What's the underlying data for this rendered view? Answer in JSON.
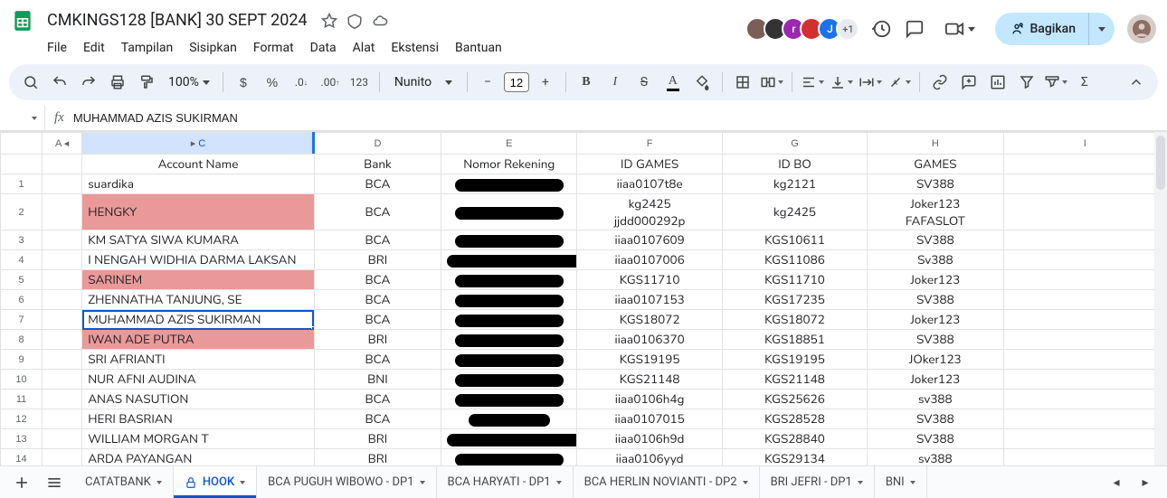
{
  "doc": {
    "title": "CMKINGS128 [BANK] 30 SEPT 2024"
  },
  "menus": {
    "file": "File",
    "edit": "Edit",
    "view": "Tampilan",
    "insert": "Sisipkan",
    "format": "Format",
    "data": "Data",
    "tools": "Alat",
    "ext": "Ekstensi",
    "help": "Bantuan"
  },
  "share": {
    "label": "Bagikan",
    "plus": "+1"
  },
  "toolbar": {
    "zoom": "100%",
    "font": "Nunito",
    "fontsize": "12",
    "num_token": "123"
  },
  "fx": {
    "name": "",
    "content": "MUHAMMAD AZIS SUKIRMAN"
  },
  "columns": [
    "A",
    "C",
    "D",
    "E",
    "F",
    "G",
    "H",
    "I"
  ],
  "headers": {
    "acct": "Account Name",
    "bank": "Bank",
    "rek": "Nomor Rekening",
    "idgames": "ID GAMES",
    "idbo": "ID BO",
    "games": "GAMES"
  },
  "rows": [
    {
      "n": "1",
      "acct": "suardika",
      "bank": "BCA",
      "hl": false,
      "idg": "iiaa0107t8e",
      "idbo": "kg2121",
      "games": "SV388",
      "rw": 120
    },
    {
      "n": "2",
      "acct": "HENGKY",
      "bank": "BCA",
      "hl": true,
      "idg": "kg2425\njjdd000292p",
      "idbo": "kg2425",
      "games": "Joker123\nFAFASLOT",
      "rw": 120,
      "tall": true
    },
    {
      "n": "3",
      "acct": "KM SATYA SIWA KUMARA",
      "bank": "BCA",
      "hl": false,
      "idg": "iiaa0107609",
      "idbo": "KGS10611",
      "games": "SV388",
      "rw": 120
    },
    {
      "n": "4",
      "acct": "I NENGAH WIDHIA DARMA LAKSAN",
      "bank": "BRI",
      "hl": false,
      "idg": "iiaa0107006",
      "idbo": "KGS11086",
      "games": "Sv388",
      "rw": 150
    },
    {
      "n": "5",
      "acct": "SARINEM",
      "bank": "BCA",
      "hl": true,
      "idg": "KGS11710",
      "idbo": "KGS11710",
      "games": "Joker123",
      "rw": 120
    },
    {
      "n": "6",
      "acct": "ZHENNATHA TANJUNG, SE",
      "bank": "BCA",
      "hl": false,
      "idg": "iiaa0107153",
      "idbo": "KGS17235",
      "games": "SV388",
      "rw": 120
    },
    {
      "n": "7",
      "acct": "MUHAMMAD AZIS SUKIRMAN",
      "bank": "BCA",
      "hl": false,
      "idg": "KGS18072",
      "idbo": "KGS18072",
      "games": "Joker123",
      "rw": 120,
      "active": true
    },
    {
      "n": "8",
      "acct": "IWAN ADE PUTRA",
      "bank": "BRI",
      "hl": true,
      "idg": "iiaa0106370",
      "idbo": "KGS18851",
      "games": "SV388",
      "rw": 120
    },
    {
      "n": "9",
      "acct": "SRI AFRIANTI",
      "bank": "BCA",
      "hl": false,
      "idg": "KGS19195",
      "idbo": "KGS19195",
      "games": "JOker123",
      "rw": 120
    },
    {
      "n": "10",
      "acct": "NUR AFNI AUDINA",
      "bank": "BNI",
      "hl": false,
      "idg": "KGS21148",
      "idbo": "KGS21148",
      "games": "Joker123",
      "rw": 120
    },
    {
      "n": "11",
      "acct": "ANAS NASUTION",
      "bank": "BCA",
      "hl": false,
      "idg": "iiaa0106h4g",
      "idbo": "KGS25626",
      "games": "sv388",
      "rw": 120
    },
    {
      "n": "12",
      "acct": "HERI BASRIAN",
      "bank": "BCA",
      "hl": false,
      "idg": "iiaa0107015",
      "idbo": "KGS28528",
      "games": "SV388",
      "rw": 90
    },
    {
      "n": "13",
      "acct": "WILLIAM MORGAN T",
      "bank": "BRI",
      "hl": false,
      "idg": "iiaa0106h9d",
      "idbo": "KGS28840",
      "games": "SV388",
      "rw": 150
    },
    {
      "n": "14",
      "acct": "ARDA PAYANGAN",
      "bank": "BRI",
      "hl": false,
      "idg": "iiaa0106yyd",
      "idbo": "KGS29134",
      "games": "sv388",
      "rw": 120
    }
  ],
  "sheets": [
    {
      "name": "CATATBANK",
      "active": false,
      "lock": false
    },
    {
      "name": "HOOK",
      "active": true,
      "lock": true
    },
    {
      "name": "BCA PUGUH WIBOWO - DP1",
      "active": false,
      "lock": false
    },
    {
      "name": "BCA HARYATI - DP1",
      "active": false,
      "lock": false
    },
    {
      "name": "BCA HERLIN NOVIANTI - DP2",
      "active": false,
      "lock": false
    },
    {
      "name": "BRI JEFRI - DP1",
      "active": false,
      "lock": false
    },
    {
      "name": "BNI",
      "active": false,
      "lock": false
    }
  ],
  "avatars": [
    {
      "bg": "#7b5e57",
      "t": ""
    },
    {
      "bg": "#333",
      "t": ""
    },
    {
      "bg": "#9c27b0",
      "t": "r"
    },
    {
      "bg": "#d32f2f",
      "t": ""
    },
    {
      "bg": "#1a73e8",
      "t": "J"
    }
  ]
}
